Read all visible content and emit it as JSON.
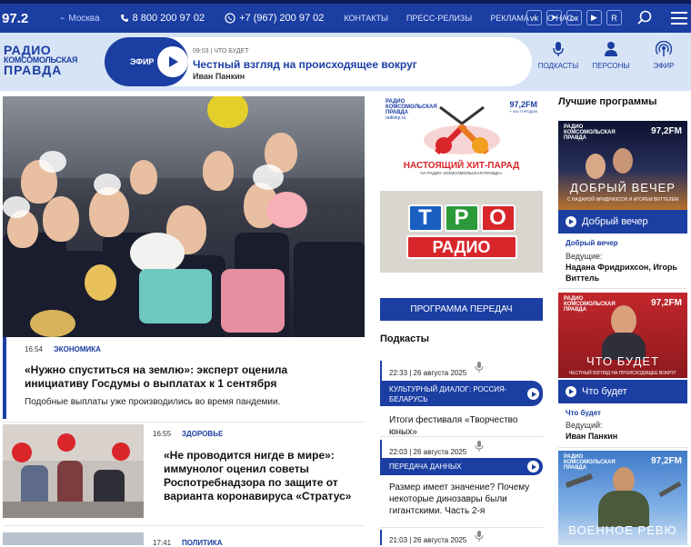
{
  "topbar": {
    "frequency": "97.2",
    "city": "Москва",
    "phone1": "8 800 200 97 02",
    "phone2": "+7 (967) 200 97 02",
    "nav": [
      "КОНТАКТЫ",
      "ПРЕСС-РЕЛИЗЫ",
      "РЕКЛАМА",
      "О НАС"
    ],
    "socials": [
      "vk-icon",
      "telegram-icon",
      "ok-icon",
      "youtube-icon",
      "rutube-icon"
    ]
  },
  "header": {
    "logo": [
      "РАДИО",
      "КОМСОМОЛЬСКАЯ",
      "ПРАВДА"
    ],
    "efir_label": "ЭФИР",
    "now_time": "09:03 | ЧТО БУДЕТ",
    "now_title": "Честный взгляд на происходящее вокруг",
    "now_host": "Иван Панкин",
    "icons": [
      {
        "label": "ПОДКАСТЫ",
        "icon": "microphone-icon"
      },
      {
        "label": "ПЕРСОНЫ",
        "icon": "person-icon"
      },
      {
        "label": "ЭФИР",
        "icon": "broadcast-icon"
      }
    ]
  },
  "news": [
    {
      "time": "16:54",
      "category": "ЭКОНОМИКА",
      "title": "«Нужно спуститься на землю»: эксперт оценила инициативу Госдумы о выплатах к 1 сентября",
      "lead": "Подобные выплаты уже производились во время пандемии."
    },
    {
      "time": "16:55",
      "category": "ЗДОРОВЬЕ",
      "title": "«Не проводится нигде в мире»: иммунолог оценил советы Роспотребнадзора по защите от варианта коронавируса «Стратус»"
    },
    {
      "time": "17:41",
      "category": "ПОЛИТИКА"
    }
  ],
  "middle": {
    "banner1": {
      "logo": [
        "РАДИО",
        "КОМСОМОЛЬСКАЯ",
        "ПРАВДА"
      ],
      "url": "radiokp.ru",
      "fm": "97,2FM",
      "fm_sub": "+ 400 ГОРОДОВ",
      "title": "НАСТОЯЩИЙ ХИТ-ПАРАД",
      "subtitle": "НА РАДИО «КОМСОМОЛЬСКАЯ ПРАВДА»"
    },
    "banner2": {
      "top": "ТРО",
      "bottom": "РАДИО"
    },
    "program_button": "ПРОГРАММА ПЕРЕДАЧ",
    "podcasts_title": "Подкасты",
    "podcasts": [
      {
        "meta": "22:33 | 26 августа 2025",
        "show": "КУЛЬТУРНЫЙ ДИАЛОГ: РОССИЯ-БЕЛАРУСЬ",
        "title": "Итоги фестиваля «Творчество юных»"
      },
      {
        "meta": "22:03 | 26 августа 2025",
        "show": "ПЕРЕДАЧА ДАННЫХ",
        "title": "Размер имеет значение? Почему некоторые динозавры были гигантскими. Часть 2-я"
      },
      {
        "meta": "21:03 | 26 августа 2025"
      }
    ]
  },
  "best": {
    "title": "Лучшие программы",
    "items": [
      {
        "name": "Добрый вечер",
        "cover": "ДОБРЫЙ ВЕЧЕР",
        "cover_sub": "С НАДАНОЙ ФРИДРИХСОН И ИГОРЕМ ВИТТЕЛЕМ",
        "sub": "Добрый вечер",
        "hosts_label": "Ведущие:",
        "hosts": "Надана Фридрихсон, Игорь Виттель"
      },
      {
        "name": "Что будет",
        "cover": "ЧТО БУДЕТ",
        "cover_sub": "ЧЕСТНЫЙ ВЗГЛЯД НА ПРОИСХОДЯЩЕЕ ВОКРУГ",
        "sub": "Что будет",
        "hosts_label": "Ведущий:",
        "hosts": "Иван Панкин"
      },
      {
        "cover": "ВОЕННОЕ РЕВЮ"
      }
    ],
    "cover_logo": [
      "РАДИО",
      "КОМСОМОЛЬСКАЯ",
      "ПРАВДА"
    ],
    "cover_fm": "97,2FM",
    "cover_url": "radiokp.ru"
  },
  "colors": {
    "brand": "#1b3ea3",
    "header_bg": "#d7e4f5",
    "accent_red": "#d9262b"
  }
}
